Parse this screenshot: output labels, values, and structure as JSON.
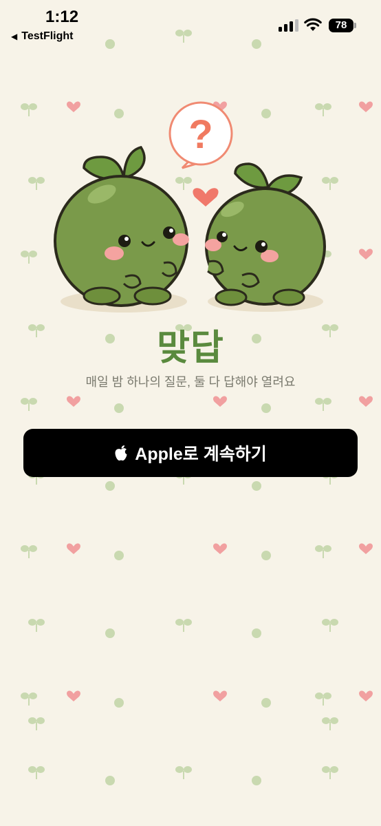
{
  "status_bar": {
    "time": "1:12",
    "back_app": "TestFlight",
    "battery": "78"
  },
  "main": {
    "title": "맞답",
    "subtitle": "매일 밤 하나의 질문, 둘 다 답해야 열려요",
    "apple_button_label": "Apple로 계속하기",
    "question_mark": "?"
  },
  "colors": {
    "background": "#f7f3e8",
    "title_green": "#5a8a3e",
    "button": "#000000",
    "mascot_green": "#7a9a4a",
    "heart_pink": "#f1a0a0",
    "sprout_green": "#c9d9b0"
  }
}
